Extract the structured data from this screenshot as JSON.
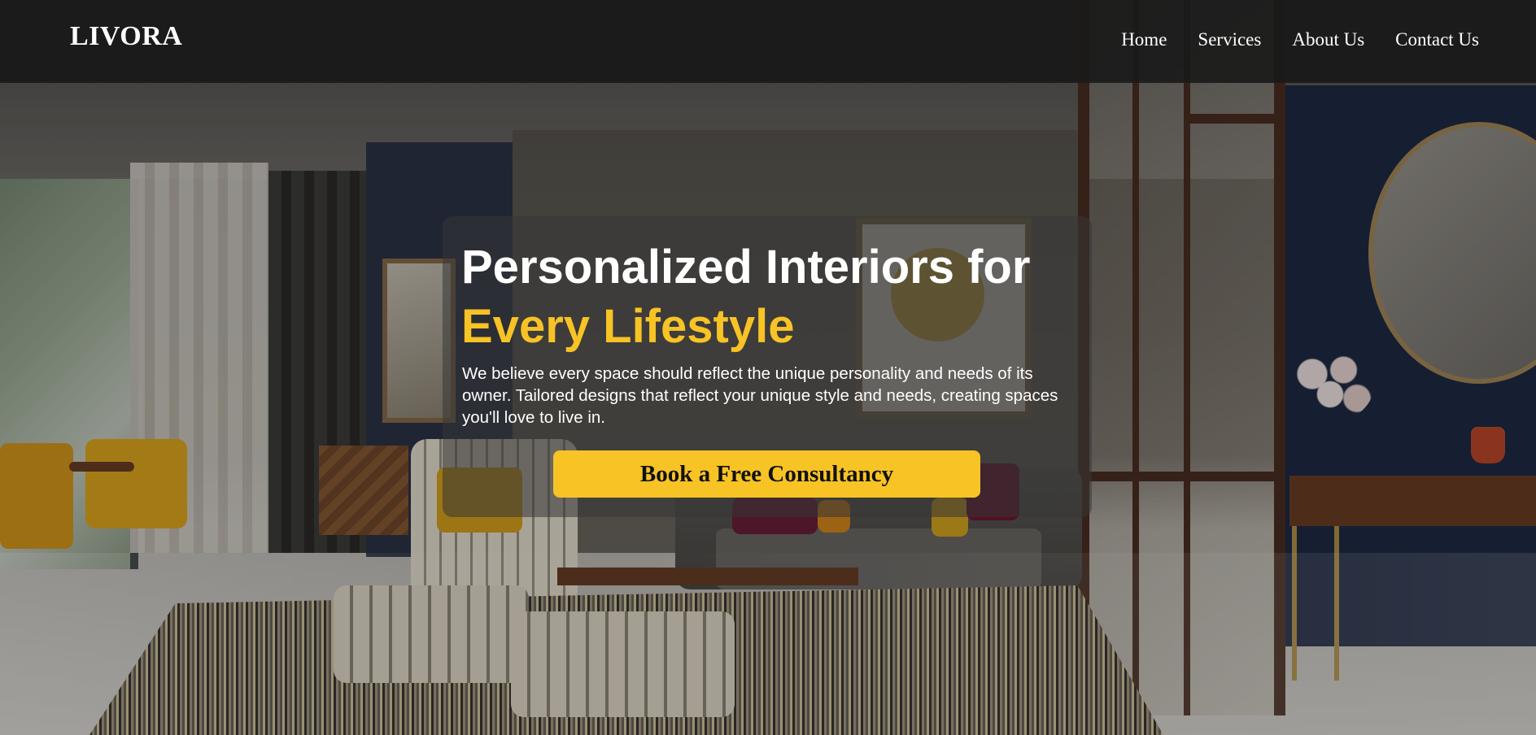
{
  "brand": {
    "logo_text": "LIVORA"
  },
  "nav": {
    "items": [
      {
        "label": "Home"
      },
      {
        "label": "Services"
      },
      {
        "label": "About Us"
      },
      {
        "label": "Contact Us"
      }
    ]
  },
  "hero": {
    "title_line1": "Personalized Interiors for",
    "title_line2": "Every Lifestyle",
    "description": "We believe every space should reflect the unique personality and needs of its owner. Tailored designs that reflect your unique style and needs, creating spaces you'll love to live in.",
    "cta_label": "Book a Free Consultancy"
  },
  "colors": {
    "accent": "#f7c325",
    "header_bg": "#191919",
    "text": "#ffffff"
  }
}
